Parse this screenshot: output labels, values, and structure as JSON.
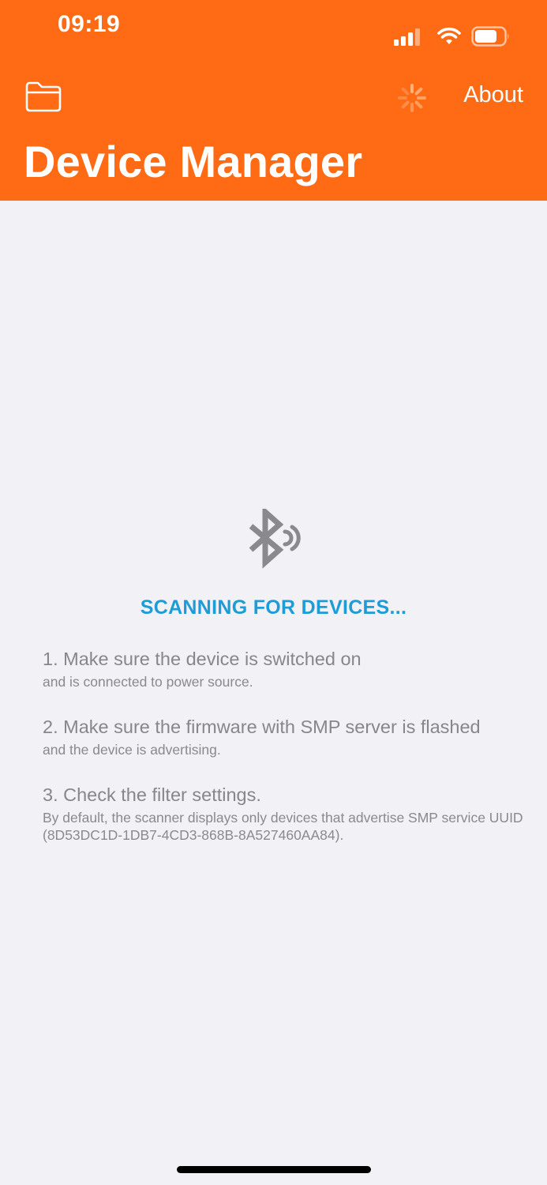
{
  "status_bar": {
    "time": "09:19",
    "icons": [
      "cellular-signal-icon",
      "wifi-icon",
      "battery-icon"
    ]
  },
  "nav_bar": {
    "left_icon": "folder-icon",
    "activity_icon": "activity-spinner-icon",
    "about_label": "About",
    "title": "Device Manager",
    "background_color": "#FF6A14"
  },
  "scan": {
    "icon": "bluetooth-searching-icon",
    "status_text": "SCANNING FOR DEVICES...",
    "status_color": "#1E9CD7"
  },
  "tips": [
    {
      "title": "1. Make sure the device is switched on",
      "description": "and is connected to power source."
    },
    {
      "title": "2. Make sure the firmware with SMP server is flashed",
      "description": "and the device is advertising."
    },
    {
      "title": "3. Check the filter settings.",
      "description": "By default, the scanner displays only devices that advertise SMP service UUID (8D53DC1D-1DB7-4CD3-868B-8A527460AA84)."
    }
  ]
}
